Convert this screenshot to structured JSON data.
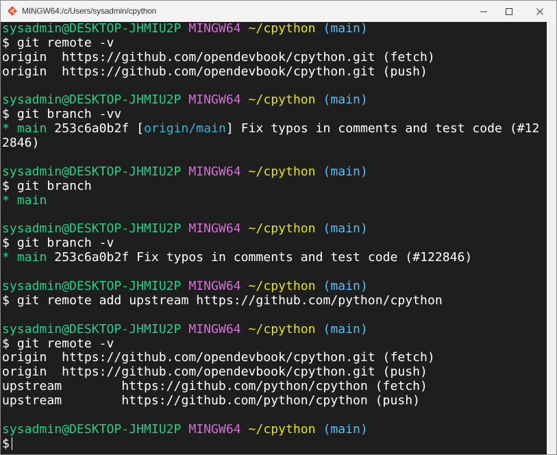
{
  "window": {
    "title": "MINGW64:/c/Users/sysadmin/cpython",
    "icon": "git-bash-icon",
    "controls": [
      "minimize-icon",
      "maximize-icon",
      "close-icon"
    ]
  },
  "prompt": {
    "user_host": "sysadmin@DESKTOP-JHMIU2P",
    "env": "MINGW64",
    "path": "~/cpython",
    "branch": "(main)",
    "symbol": "$"
  },
  "blocks": [
    {
      "command": "git remote -v",
      "output": [
        "origin  https://github.com/opendevbook/cpython.git (fetch)",
        "origin  https://github.com/opendevbook/cpython.git (push)"
      ]
    },
    {
      "command": "git branch -vv",
      "branch_line": {
        "star": "*",
        "name": "main",
        "hash": "253c6a0b2f",
        "tracking_open": "[",
        "tracking": "origin/main",
        "tracking_close": "]",
        "message": "Fix typos in comments and test code (#12",
        "wrap": "2846)"
      }
    },
    {
      "command": "git branch",
      "branch_line": {
        "star": "*",
        "name": "main"
      }
    },
    {
      "command": "git branch -v",
      "branch_line": {
        "star": "*",
        "name": "main",
        "rest": "253c6a0b2f Fix typos in comments and test code (#122846)"
      }
    },
    {
      "command": "git remote add upstream https://github.com/python/cpython"
    },
    {
      "command": "git remote -v",
      "output": [
        "origin  https://github.com/opendevbook/cpython.git (fetch)",
        "origin  https://github.com/opendevbook/cpython.git (push)",
        "upstream        https://github.com/python/cpython (fetch)",
        "upstream        https://github.com/python/cpython (push)"
      ]
    }
  ],
  "colors": {
    "background": "#1e1e1e",
    "user_host": "#23d18b",
    "env": "#d670d6",
    "path": "#e5e510",
    "branch": "#4fc1ff",
    "titlebar": "#f3f3f3"
  }
}
